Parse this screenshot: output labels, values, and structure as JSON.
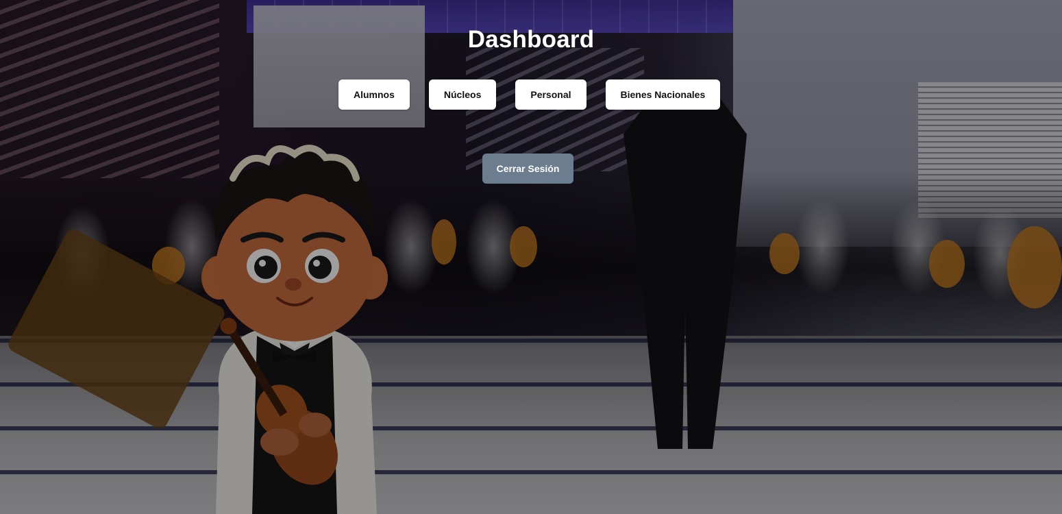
{
  "page": {
    "title": "Dashboard"
  },
  "nav": {
    "items": [
      {
        "label": "Alumnos"
      },
      {
        "label": "Núcleos"
      },
      {
        "label": "Personal"
      },
      {
        "label": "Bienes Nacionales"
      }
    ]
  },
  "actions": {
    "logout_label": "Cerrar Sesión"
  },
  "theme": {
    "button_bg": "#ffffff",
    "logout_bg": "#6b7d8f",
    "title_color": "#ffffff"
  }
}
